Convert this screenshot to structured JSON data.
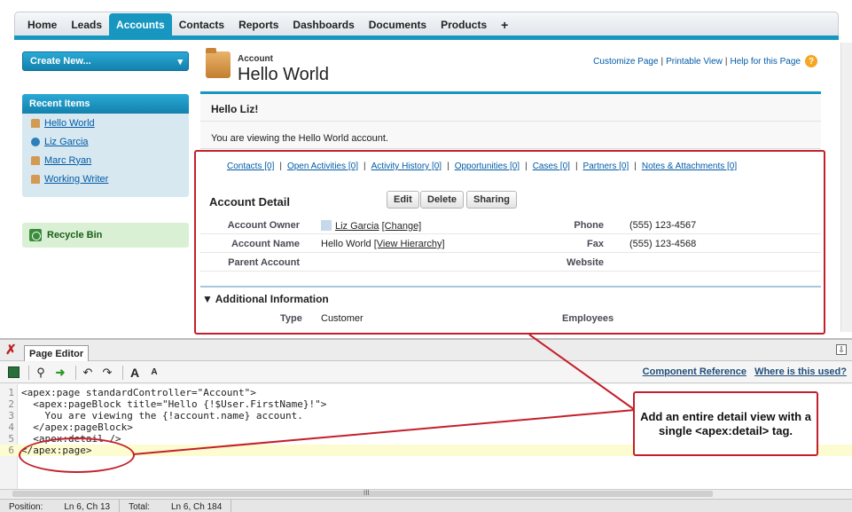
{
  "tabs": [
    "Home",
    "Leads",
    "Accounts",
    "Contacts",
    "Reports",
    "Dashboards",
    "Documents",
    "Products",
    "+"
  ],
  "active_tab": "Accounts",
  "sidebar": {
    "create_new": "Create New...",
    "recent_title": "Recent Items",
    "recent_items": [
      {
        "label": "Hello World",
        "icon": "account-icon"
      },
      {
        "label": "Liz Garcia",
        "icon": "contact-icon"
      },
      {
        "label": "Marc Ryan",
        "icon": "account-icon"
      },
      {
        "label": "Working Writer",
        "icon": "account-icon"
      }
    ],
    "recycle_bin": "Recycle Bin"
  },
  "header": {
    "object_label": "Account",
    "record_title": "Hello World",
    "links": [
      "Customize Page",
      "Printable View",
      "Help for this Page"
    ]
  },
  "hello_block": {
    "title": "Hello Liz!",
    "text": "You are viewing the Hello World account."
  },
  "related_links": [
    "Contacts [0]",
    "Open Activities [0]",
    "Activity History [0]",
    "Opportunities [0]",
    "Cases [0]",
    "Partners [0]",
    "Notes & Attachments [0]"
  ],
  "detail": {
    "title": "Account Detail",
    "buttons": [
      "Edit",
      "Delete",
      "Sharing"
    ],
    "fields": [
      {
        "label": "Account Owner",
        "value": "Liz Garcia",
        "link": "[Change]",
        "label2": "Phone",
        "value2": "(555) 123-4567"
      },
      {
        "label": "Account Name",
        "value": "Hello World",
        "link": "[View Hierarchy]",
        "label2": "Fax",
        "value2": "(555) 123-4568"
      },
      {
        "label": "Parent Account",
        "value": "",
        "link": "",
        "label2": "Website",
        "value2": ""
      }
    ],
    "additional_title": "▼ Additional Information",
    "type_label": "Type",
    "type_value": "Customer",
    "employees_label": "Employees"
  },
  "editor": {
    "tab_label": "Page Editor",
    "comp_ref": "Component Reference",
    "where_used": "Where is this used?",
    "code_lines": [
      "<apex:page standardController=\"Account\">",
      "  <apex:pageBlock title=\"Hello {!$User.FirstName}!\">",
      "    You are viewing the {!account.name} account.",
      "  </apex:pageBlock>",
      "  <apex:detail />",
      "</apex:page>"
    ],
    "current_line": 6,
    "scroll_marker": "III",
    "status": {
      "position_label": "Position:",
      "position_value": "Ln 6, Ch 13",
      "total_label": "Total:",
      "total_value": "Ln 6, Ch 184"
    }
  },
  "callout": "Add an entire detail view with a single <apex:detail> tag.",
  "colors": {
    "accent": "#1797c0",
    "highlight": "#c3202b"
  }
}
